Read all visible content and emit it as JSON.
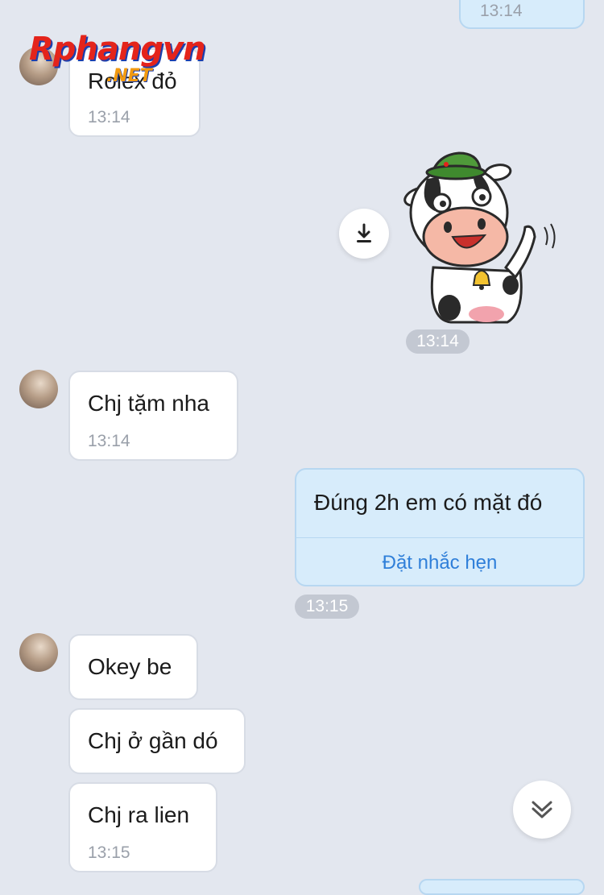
{
  "messages": {
    "top_sent": {
      "time": "13:14"
    },
    "rolex": {
      "text": "Rolex đỏ",
      "time": "13:14"
    },
    "sticker": {
      "time": "13:14"
    },
    "chj_tam": {
      "text": "Chj tặm nha",
      "time": "13:14"
    },
    "dung_2h": {
      "text": "Đúng 2h em có mặt đó",
      "remind_label": "Đặt nhắc hẹn",
      "time": "13:15"
    },
    "okey": {
      "text": "Okey be"
    },
    "chj_o_gan": {
      "text": "Chj ở gần dó"
    },
    "chj_ra": {
      "text": "Chj ra lien",
      "time": "13:15"
    }
  },
  "watermark": {
    "main": "Rphangvn",
    "sub": ".NET"
  },
  "icons": {
    "download": "download-icon",
    "scroll_down": "double-chevron-down-icon"
  },
  "colors": {
    "background": "#e3e7ef",
    "incoming_bubble": "#ffffff",
    "outgoing_bubble": "#d7ecfb",
    "link": "#2f7fd9",
    "time_pill": "#c3c8d2"
  }
}
